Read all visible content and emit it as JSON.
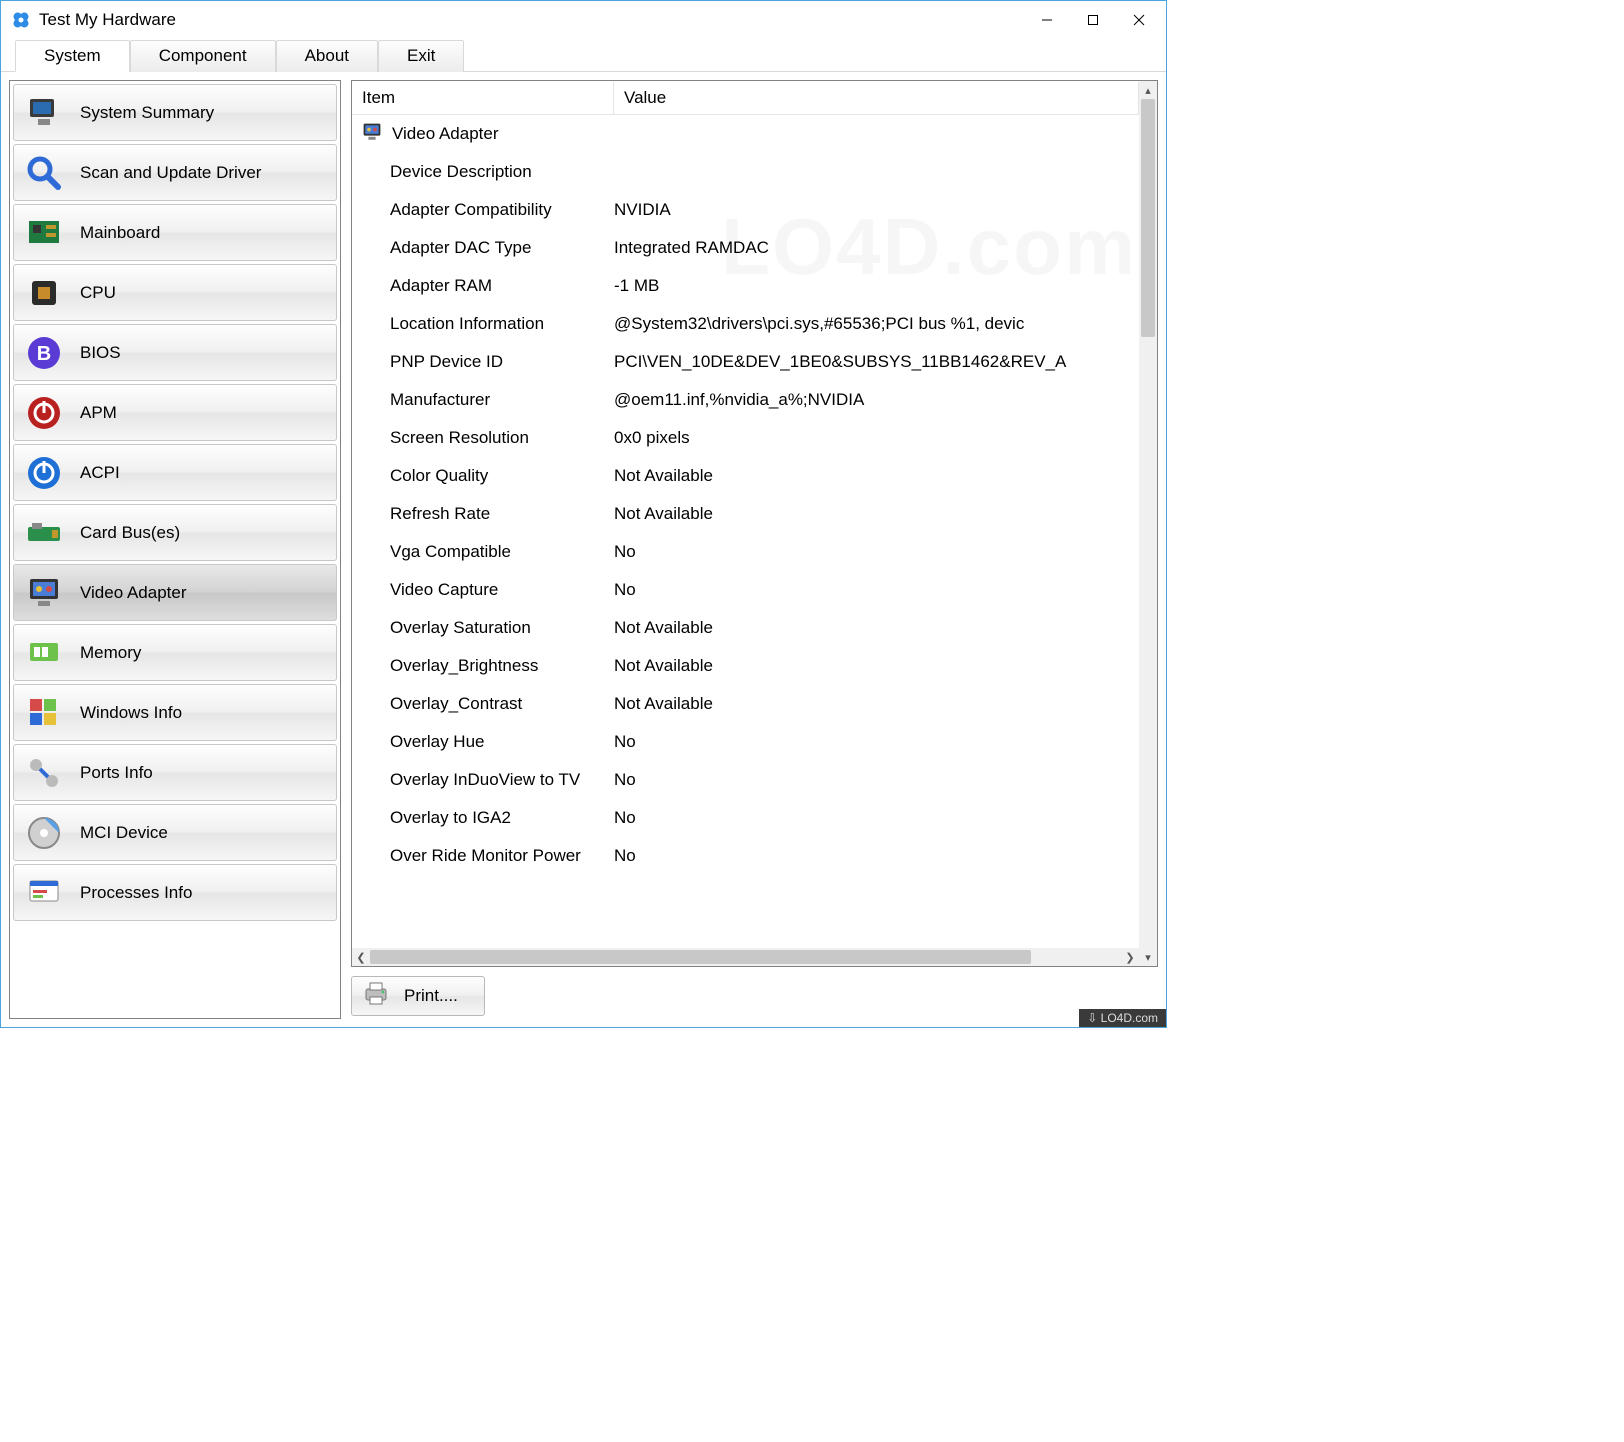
{
  "window": {
    "title": "Test My  Hardware"
  },
  "tabs": [
    "System",
    "Component",
    "About",
    "Exit"
  ],
  "active_tab": 0,
  "sidebar": {
    "items": [
      {
        "label": "System Summary",
        "icon": "monitor"
      },
      {
        "label": "Scan and Update Driver",
        "icon": "magnifier"
      },
      {
        "label": "Mainboard",
        "icon": "board"
      },
      {
        "label": "CPU",
        "icon": "cpu"
      },
      {
        "label": "BIOS",
        "icon": "bios"
      },
      {
        "label": "APM",
        "icon": "power-red"
      },
      {
        "label": "ACPI",
        "icon": "power-blue"
      },
      {
        "label": "Card Bus(es)",
        "icon": "card"
      },
      {
        "label": "Video Adapter",
        "icon": "video"
      },
      {
        "label": "Memory",
        "icon": "memory"
      },
      {
        "label": "Windows Info",
        "icon": "windows"
      },
      {
        "label": "Ports Info",
        "icon": "ports"
      },
      {
        "label": "MCI Device",
        "icon": "mci"
      },
      {
        "label": "Processes Info",
        "icon": "processes"
      }
    ],
    "selected_index": 8
  },
  "grid": {
    "headers": {
      "item": "Item",
      "value": "Value"
    },
    "root": "Video Adapter",
    "rows": [
      {
        "item": "Device Description",
        "value": ""
      },
      {
        "item": "Adapter Compatibility",
        "value": "NVIDIA"
      },
      {
        "item": "Adapter DAC Type",
        "value": "Integrated RAMDAC"
      },
      {
        "item": "Adapter RAM",
        "value": "-1 MB"
      },
      {
        "item": "Location Information",
        "value": "@System32\\drivers\\pci.sys,#65536;PCI bus %1, devic"
      },
      {
        "item": "PNP Device ID",
        "value": "PCI\\VEN_10DE&DEV_1BE0&SUBSYS_11BB1462&REV_A"
      },
      {
        "item": "Manufacturer",
        "value": "@oem11.inf,%nvidia_a%;NVIDIA"
      },
      {
        "item": "Screen Resolution",
        "value": "0x0 pixels"
      },
      {
        "item": "Color Quality",
        "value": "Not Available"
      },
      {
        "item": "Refresh Rate",
        "value": "Not Available"
      },
      {
        "item": "Vga Compatible",
        "value": "No"
      },
      {
        "item": "Video Capture",
        "value": "No"
      },
      {
        "item": "Overlay Saturation",
        "value": "Not Available"
      },
      {
        "item": "Overlay_Brightness",
        "value": "Not Available"
      },
      {
        "item": "Overlay_Contrast",
        "value": "Not Available"
      },
      {
        "item": "Overlay Hue",
        "value": "No"
      },
      {
        "item": "Overlay InDuoView to TV",
        "value": "No"
      },
      {
        "item": "Overlay to IGA2",
        "value": "No"
      },
      {
        "item": "Over Ride Monitor Power",
        "value": "No"
      }
    ]
  },
  "print_label": "Print....",
  "watermark": "LO4D.com"
}
